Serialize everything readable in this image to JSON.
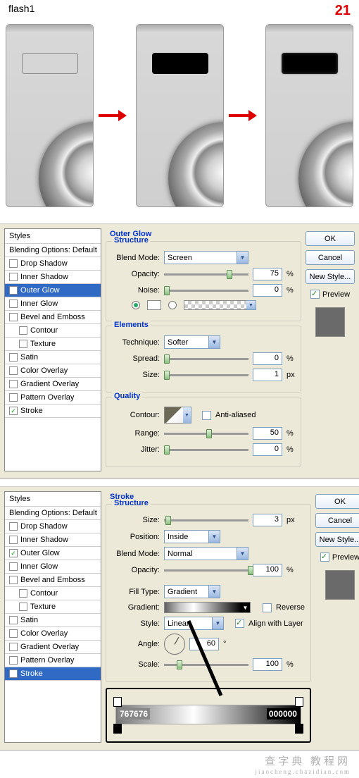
{
  "header": {
    "label": "flash1",
    "step": "21"
  },
  "styles_panel": {
    "title": "Styles",
    "blending": "Blending Options: Default",
    "items": [
      {
        "label": "Drop Shadow",
        "checked": false
      },
      {
        "label": "Inner Shadow",
        "checked": false
      },
      {
        "label": "Outer Glow",
        "checked": true
      },
      {
        "label": "Inner Glow",
        "checked": false
      },
      {
        "label": "Bevel and Emboss",
        "checked": false
      },
      {
        "label": "Contour",
        "checked": false,
        "indent": true
      },
      {
        "label": "Texture",
        "checked": false,
        "indent": true
      },
      {
        "label": "Satin",
        "checked": false
      },
      {
        "label": "Color Overlay",
        "checked": false
      },
      {
        "label": "Gradient Overlay",
        "checked": false
      },
      {
        "label": "Pattern Overlay",
        "checked": false
      },
      {
        "label": "Stroke",
        "checked": true
      }
    ]
  },
  "outer_glow": {
    "panel_title": "Outer Glow",
    "structure_title": "Structure",
    "blend_mode_label": "Blend Mode:",
    "blend_mode": "Screen",
    "opacity_label": "Opacity:",
    "opacity": "75",
    "noise_label": "Noise:",
    "noise": "0",
    "percent": "%",
    "elements_title": "Elements",
    "technique_label": "Technique:",
    "technique": "Softer",
    "spread_label": "Spread:",
    "spread": "0",
    "size_label": "Size:",
    "size": "1",
    "px": "px",
    "quality_title": "Quality",
    "contour_label": "Contour:",
    "anti_aliased_label": "Anti-aliased",
    "range_label": "Range:",
    "range": "50",
    "jitter_label": "Jitter:",
    "jitter": "0"
  },
  "stroke": {
    "panel_title": "Stroke",
    "structure_title": "Structure",
    "size_label": "Size:",
    "size": "3",
    "px": "px",
    "position_label": "Position:",
    "position": "Inside",
    "blend_mode_label": "Blend Mode:",
    "blend_mode": "Normal",
    "opacity_label": "Opacity:",
    "opacity": "100",
    "percent": "%",
    "fill_type_label": "Fill Type:",
    "fill_type": "Gradient",
    "gradient_label": "Gradient:",
    "reverse_label": "Reverse",
    "style_label": "Style:",
    "style": "Linear",
    "align_label": "Align with Layer",
    "angle_label": "Angle:",
    "angle": "60",
    "deg": "°",
    "scale_label": "Scale:",
    "scale": "100",
    "stops": {
      "left": "767676",
      "right": "000000"
    }
  },
  "buttons": {
    "ok": "OK",
    "cancel": "Cancel",
    "new_style": "New Style...",
    "preview": "Preview"
  },
  "watermark": {
    "main": "查字典 教程网",
    "sub": "jiaocheng.chazidian.com"
  }
}
